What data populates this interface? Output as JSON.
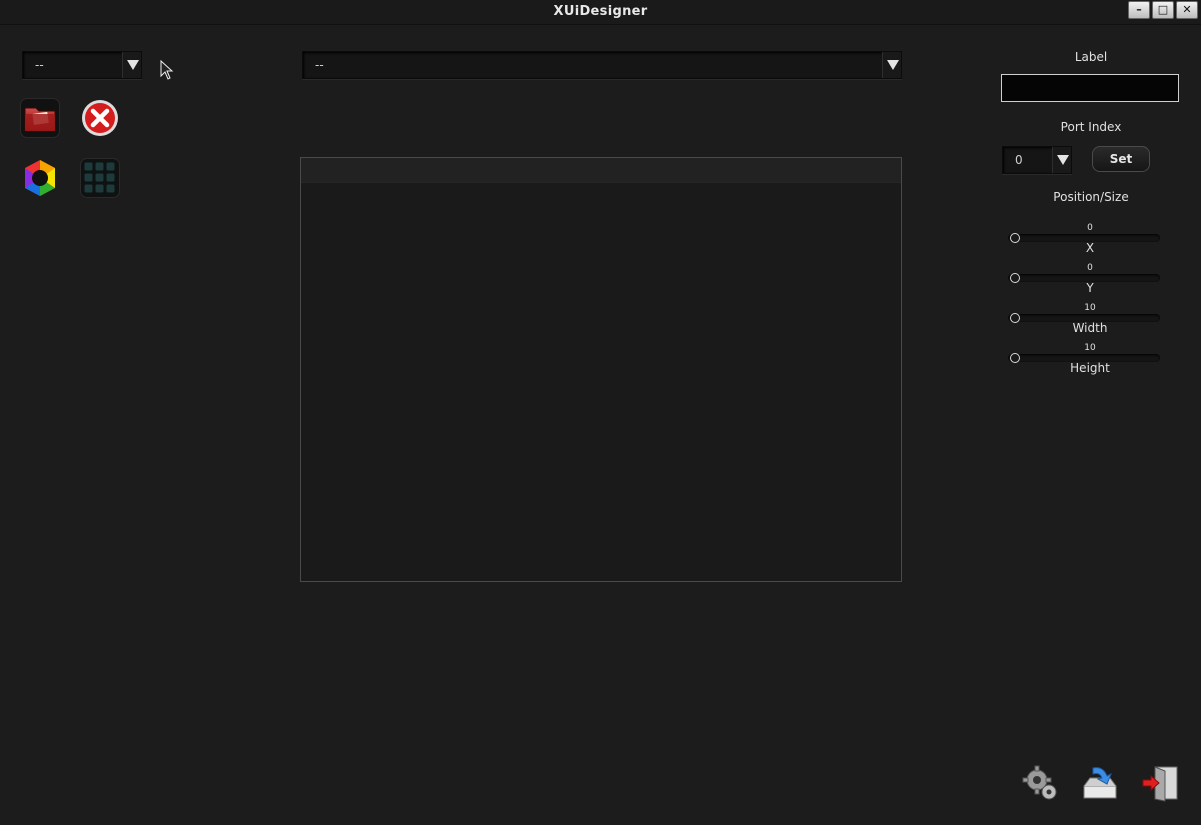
{
  "window": {
    "title": "XUiDesigner"
  },
  "window_buttons": [
    "–",
    "□",
    "✕"
  ],
  "left_combo": {
    "value": "--"
  },
  "main_combo": {
    "value": "--"
  },
  "properties": {
    "label_heading": "Label",
    "label_value": "",
    "port_heading": "Port Index",
    "port_value": "0",
    "set_label": "Set",
    "position_heading": "Position/Size",
    "sliders": [
      {
        "name": "X",
        "value": "0"
      },
      {
        "name": "Y",
        "value": "0"
      },
      {
        "name": "Width",
        "value": "10"
      },
      {
        "name": "Height",
        "value": "10"
      }
    ]
  },
  "icons": {
    "tools": [
      "folder-icon",
      "close-circle-icon",
      "color-wheel-icon",
      "grid-icon"
    ],
    "bottom": [
      "gear-icon",
      "download-icon",
      "exit-icon"
    ]
  }
}
